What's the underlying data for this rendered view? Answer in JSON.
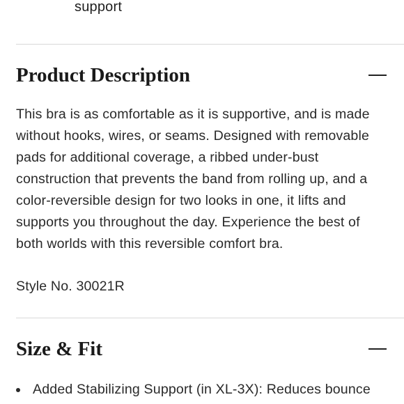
{
  "feature": {
    "label": "support",
    "icon": "bra-outline-icon"
  },
  "product_description": {
    "title": "Product Description",
    "toggle_icon": "minus-icon",
    "lines": [
      "This bra is as comfortable as it is supportive, and is made",
      "without hooks, wires, or seams. Designed with removable",
      "pads for additional coverage, a ribbed under-bust",
      "construction that prevents the band from rolling up, and a",
      "color-reversible design for two looks in one, it lifts and",
      "supports you throughout the day. Experience the best of",
      "both worlds with this reversible comfort bra."
    ],
    "style_number": "Style No. 30021R"
  },
  "size_fit": {
    "title": "Size & Fit",
    "toggle_icon": "minus-icon",
    "bullets": [
      "Added Stabilizing Support (in XL-3X): Reduces bounce"
    ]
  }
}
